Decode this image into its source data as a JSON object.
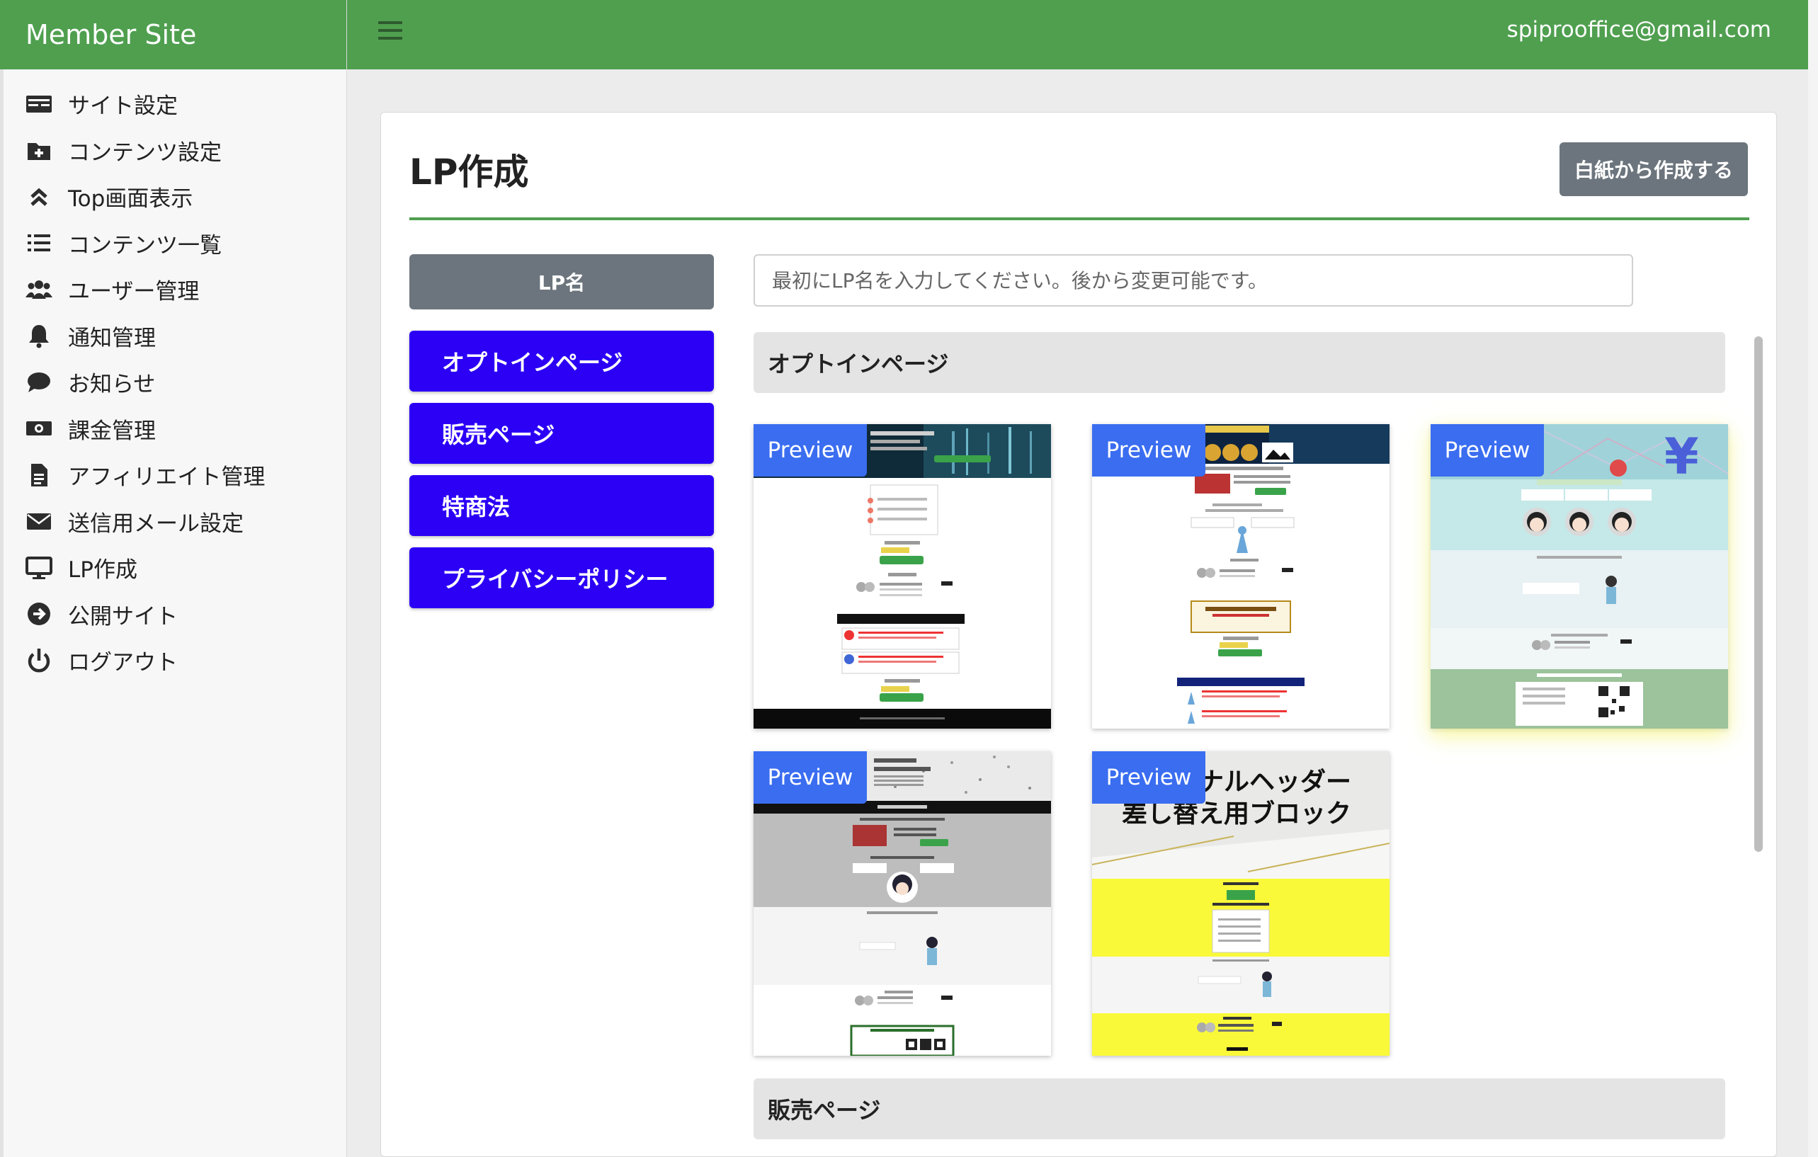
{
  "brand": {
    "name": "Member Site"
  },
  "user": {
    "email": "spiprooffice@gmail.com"
  },
  "sidebar": {
    "items": [
      {
        "label": "サイト設定",
        "icon": "card-icon"
      },
      {
        "label": "コンテンツ設定",
        "icon": "folder-plus-icon"
      },
      {
        "label": "Top画面表示",
        "icon": "double-chevron-up-icon"
      },
      {
        "label": "コンテンツ一覧",
        "icon": "list-icon"
      },
      {
        "label": "ユーザー管理",
        "icon": "users-icon"
      },
      {
        "label": "通知管理",
        "icon": "bell-icon"
      },
      {
        "label": "お知らせ",
        "icon": "comment-icon"
      },
      {
        "label": "課金管理",
        "icon": "money-icon"
      },
      {
        "label": "アフィリエイト管理",
        "icon": "document-icon"
      },
      {
        "label": "送信用メール設定",
        "icon": "envelope-icon"
      },
      {
        "label": "LP作成",
        "icon": "monitor-icon"
      },
      {
        "label": "公開サイト",
        "icon": "arrow-circle-right-icon"
      },
      {
        "label": "ログアウト",
        "icon": "power-icon"
      }
    ]
  },
  "main": {
    "title": "LP作成",
    "blank_button": "白紙から作成する",
    "lp_name_label": "LP名",
    "lp_name_placeholder": "最初にLP名を入力してください。後から変更可能です。",
    "section_buttons": [
      "オプトインページ",
      "販売ページ",
      "特商法",
      "プライバシーポリシー"
    ],
    "sections": [
      {
        "title": "オプトインページ"
      },
      {
        "title": "販売ページ"
      }
    ],
    "templates": [
      {
        "badge": "Preview"
      },
      {
        "badge": "Preview"
      },
      {
        "badge": "Preview"
      },
      {
        "badge": "Preview"
      },
      {
        "badge": "Preview",
        "header_text_1": "ナルヘッダー",
        "header_text_2": "差し替え用ブロック"
      }
    ]
  },
  "colors": {
    "brand_green": "#4f9f4f",
    "section_button_blue": "#2b00f5",
    "preview_badge_blue": "#3a6df0",
    "grey_button": "#6c757d"
  }
}
